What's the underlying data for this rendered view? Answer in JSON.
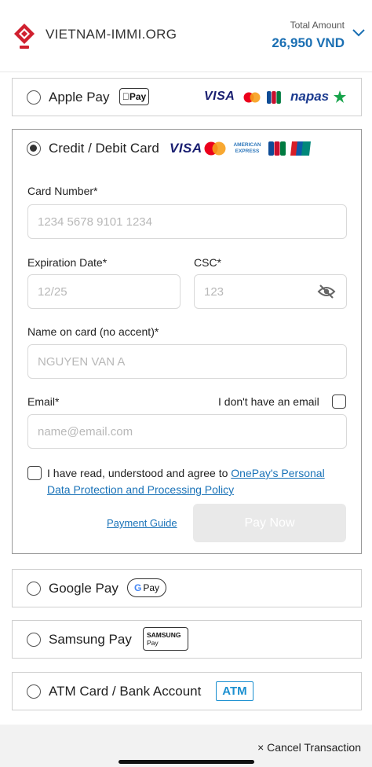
{
  "header": {
    "site_name": "VIETNAM-IMMI.ORG",
    "total_label": "Total Amount",
    "total_amount": "26,950 VND"
  },
  "apple_pay": {
    "label": "Apple Pay",
    "badge": "Pay",
    "brands": [
      "VISA",
      "Mastercard",
      "JCB",
      "napas"
    ]
  },
  "card": {
    "label": "Credit / Debit Card",
    "brands": [
      "VISA",
      "Mastercard",
      "AMERICAN EXPRESS",
      "JCB",
      "UnionPay"
    ],
    "card_number": {
      "label": "Card Number*",
      "placeholder": "1234 5678 9101 1234"
    },
    "expiration": {
      "label": "Expiration Date*",
      "placeholder": "12/25"
    },
    "csc": {
      "label": "CSC*",
      "placeholder": "123"
    },
    "name": {
      "label": "Name on card (no accent)*",
      "placeholder": "NGUYEN VAN A"
    },
    "email": {
      "label": "Email*",
      "placeholder": "name@email.com",
      "no_email_label": "I don't have an email"
    },
    "agree_prefix": "I have read, understood and agree to ",
    "agree_link": "OnePay's Personal Data Protection and Processing Policy",
    "guide_link": "Payment Guide",
    "pay_button": "Pay Now"
  },
  "google_pay": {
    "label": "Google Pay",
    "badge": "Pay"
  },
  "samsung_pay": {
    "label": "Samsung Pay",
    "badge_top": "SAMSUNG",
    "badge_bottom": "Pay"
  },
  "atm": {
    "label": "ATM Card / Bank Account",
    "badge": "ATM"
  },
  "footer": {
    "cancel_label": "× Cancel Transaction"
  },
  "colors": {
    "accent": "#1a73b8",
    "amount": "#1a6fb3",
    "logo_red": "#d0202f"
  }
}
